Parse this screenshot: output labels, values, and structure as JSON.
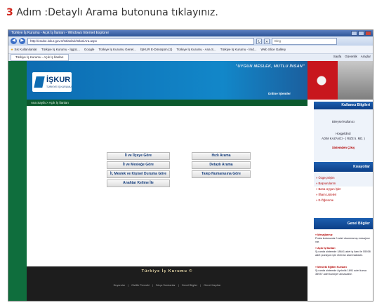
{
  "instruction": {
    "number": "3",
    "text": " Adım :Detaylı Arama butonuna tıklayınız."
  },
  "browser": {
    "title": "Türkiye İş Kurumu - Açık İş İlanları - Windows Internet Explorer",
    "url": "http://esube.iskur.gov.tr/IsIlanlari/IsIlaniAra.aspx",
    "search_placeholder": "Bing",
    "favorites": [
      "Sık Kullanılanlar",
      "Türkiye İş Kurumu - İşgüc...",
      "Google",
      "Türkiye İş Kurumu Genel...",
      "İŞKUR E-Dönüşüm (2)",
      "Türkiye İş Kurumu - Ana S...",
      "Türkiye İş Kurumu - İmd...",
      "Web Slice Gallery"
    ],
    "tab": "Türkiye İş Kurumu - Açık İş İlanları",
    "cmd": [
      "Sayfa",
      "Güvenlik",
      "Araçlar"
    ]
  },
  "site": {
    "slogan": "\"UYGUN MESLEK, MUTLU İNSAN\"",
    "logo": "İŞKUR",
    "logo_sub": "TÜRKİYE İŞ KURUMU",
    "online": "Online İşlemler",
    "breadcrumb": "Ana Sayfa > Açık İş İlanları",
    "buttons": {
      "il_ilce": "İl ve İlçeye Göre",
      "il_meslek": "İl ve Mesleğe Göre",
      "il_meslek_kisisel": "İl, Meslek ve Kişisel Duruma Göre",
      "anahtar": "Anahtar Kelime İle",
      "hizli": "Hızlı Arama",
      "detayli": "Detaylı Arama",
      "talep": "Talep Numarasına Göre"
    },
    "footer_title": "Türkiye İş Kurumu ©",
    "footer_links": [
      "Duyurular",
      "Gizlilik Prensibi",
      "Sıkça Sorulanlar",
      "Genel Bilgiler",
      "Genel Kayıtlar"
    ]
  },
  "right": {
    "user_header": "Kullanıcı Bilgileri",
    "user_type": "Bireysel Kullanıcı",
    "welcome": "Hoşgeldiniz",
    "user_name": "ADIM KAZANCI - ( RIZE 5. MD. )",
    "logout": "Sistemden Çıkış",
    "links_header": "Kısayollar",
    "links": [
      "» Özgeçmişim",
      "» Başvurularım",
      "» Bana Uygun İşler",
      "» İlham Listeleri",
      "» E-Öğrenme"
    ],
    "news_header": "Genel Bilgiler",
    "news": [
      {
        "title": "» Mesajlarınız",
        "text": "Posta kutunuzda 0 adet okunmamış mesajınız var."
      },
      {
        "title": "» Açık İş İlanları",
        "text": "Şu anda sistemde 18641 adet iş ilanı ile 55938 adet pozisyon için eleman aranmaktadır."
      },
      {
        "title": "» Mesleki Eğitim Kursları",
        "text": "Şu anda sistemde Aydınlık 1891 adet kursa 35937 adet kursiyer alınacaktır."
      }
    ]
  }
}
